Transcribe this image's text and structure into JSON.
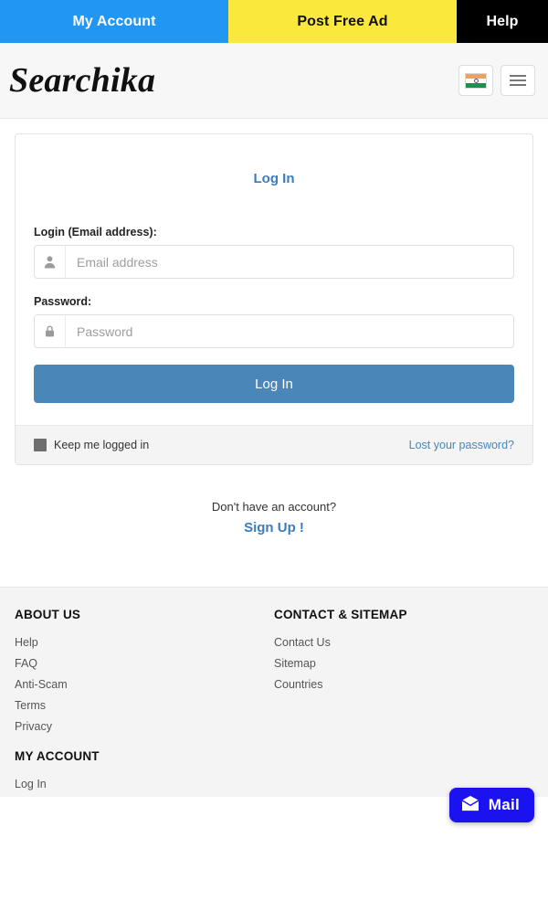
{
  "topnav": {
    "items": [
      {
        "label": "My Account",
        "color": "#2196f3"
      },
      {
        "label": "Post Free Ad",
        "color": "#fbe83c"
      },
      {
        "label": "Help",
        "color": "#000000"
      }
    ]
  },
  "header": {
    "logo": "Searchika",
    "flag_icon": "india-flag-icon",
    "menu_icon": "hamburger-menu-icon"
  },
  "login_card": {
    "title": "Log In",
    "email": {
      "label": "Login (Email address):",
      "placeholder": "Email address",
      "value": "",
      "icon": "user-icon"
    },
    "password": {
      "label": "Password:",
      "placeholder": "Password",
      "value": "",
      "icon": "lock-icon"
    },
    "submit_label": "Log In",
    "keep_logged_in_label": "Keep me logged in",
    "keep_logged_in_checked": true,
    "lost_password_label": "Lost your password?"
  },
  "signup": {
    "question": "Don't have an account?",
    "link_label": "Sign Up !"
  },
  "footer": {
    "columns": [
      {
        "heading": "ABOUT US",
        "links": [
          "Help",
          "FAQ",
          "Anti-Scam",
          "Terms",
          "Privacy"
        ],
        "heading2": "MY ACCOUNT",
        "links2": [
          "Log In"
        ]
      },
      {
        "heading": "CONTACT & SITEMAP",
        "links": [
          "Contact Us",
          "Sitemap",
          "Countries"
        ]
      }
    ]
  },
  "mail_fab": {
    "label": "Mail",
    "icon": "envelope-icon",
    "color": "#1b12f0"
  }
}
